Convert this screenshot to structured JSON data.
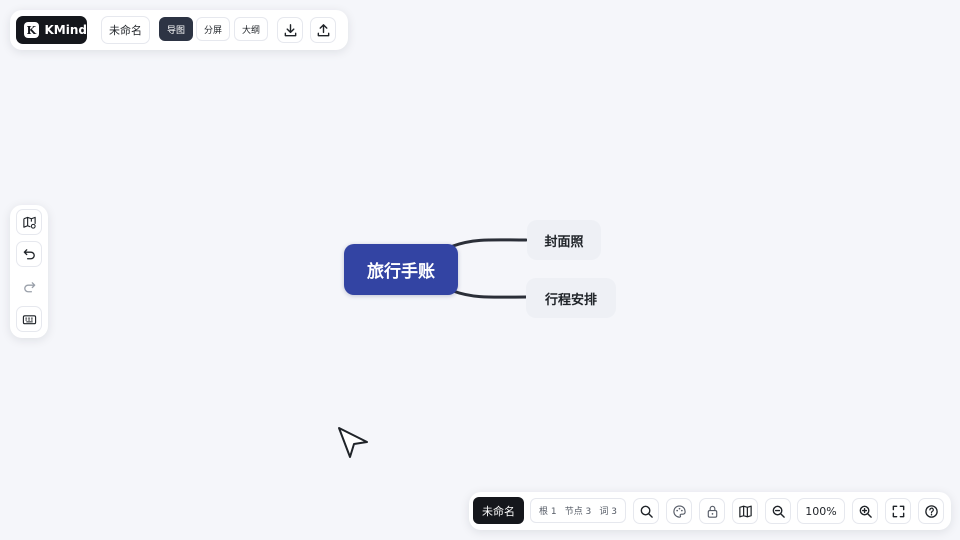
{
  "app": {
    "brand_logo": "K",
    "brand_name": "KMind"
  },
  "top_toolbar": {
    "doc_name": "未命名",
    "view_modes": [
      {
        "label": "导图",
        "active": true
      },
      {
        "label": "分屏",
        "active": false
      },
      {
        "label": "大纲",
        "active": false
      }
    ],
    "actions": [
      {
        "icon": "download-icon"
      },
      {
        "icon": "upload-icon"
      }
    ]
  },
  "left_toolbar": {
    "items": [
      {
        "icon": "map-settings-icon"
      },
      {
        "icon": "undo-icon"
      },
      {
        "icon": "redo-icon"
      },
      {
        "icon": "keyboard-icon"
      }
    ]
  },
  "mindmap": {
    "root": "旅行手账",
    "children": [
      "封面照",
      "行程安排"
    ],
    "colors": {
      "root_fill": "#3344a3",
      "child_fill": "#eef0f5",
      "branch": "#2b2f38"
    }
  },
  "bottom_bar": {
    "doc_name": "未命名",
    "stats": {
      "roots": "根 1",
      "nodes": "节点 3",
      "words": "词 3"
    },
    "zoom": "100%",
    "icons": [
      "search-icon",
      "palette-icon",
      "lock-icon",
      "book-icon",
      "zoom-out-icon",
      "zoom-in-icon",
      "fullscreen-icon",
      "help-icon"
    ]
  }
}
